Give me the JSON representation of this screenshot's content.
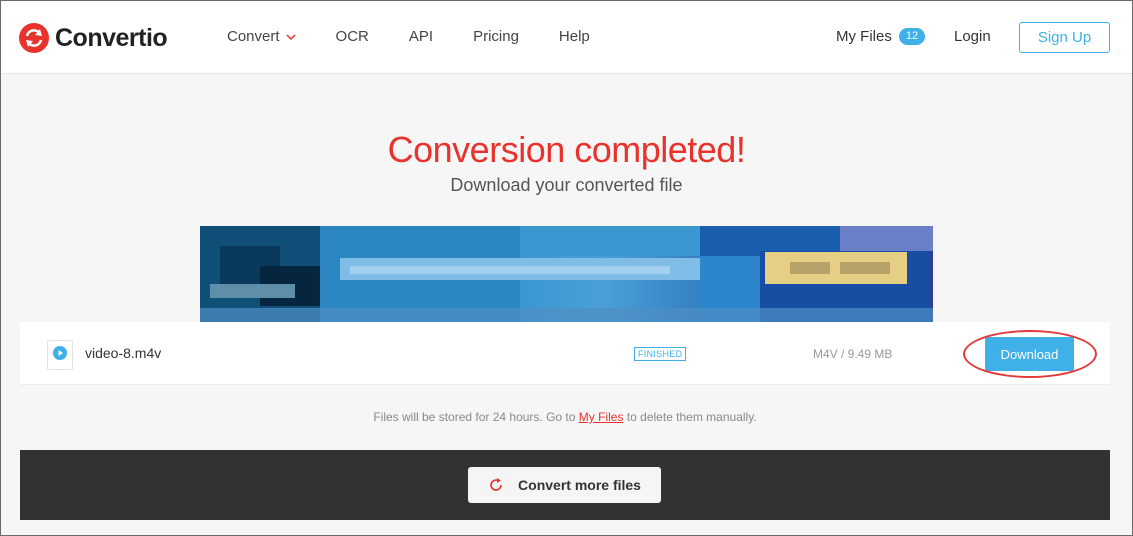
{
  "brand": {
    "name": "Convertio",
    "logo_color": "#e8322b"
  },
  "nav": {
    "items": [
      {
        "label": "Convert",
        "has_dropdown": true
      },
      {
        "label": "OCR"
      },
      {
        "label": "API"
      },
      {
        "label": "Pricing"
      },
      {
        "label": "Help"
      }
    ],
    "my_files_label": "My Files",
    "my_files_count": "12",
    "login_label": "Login",
    "signup_label": "Sign Up"
  },
  "hero": {
    "title": "Conversion completed!",
    "subtitle": "Download your converted file"
  },
  "file": {
    "icon": "play-icon",
    "name": "video-8.m4v",
    "status": "FINISHED",
    "info": "M4V / 9.49 MB",
    "download_label": "Download"
  },
  "notice": {
    "prefix": "Files will be stored for 24 hours. Go to",
    "link": "My Files",
    "suffix": "to delete them manually."
  },
  "actions": {
    "convert_more_label": "Convert more files",
    "convert_more_icon": "refresh-icon"
  },
  "colors": {
    "accent": "#3fb0e8",
    "brand_red": "#e8322b",
    "highlight_ellipse": "#e23a3a"
  }
}
